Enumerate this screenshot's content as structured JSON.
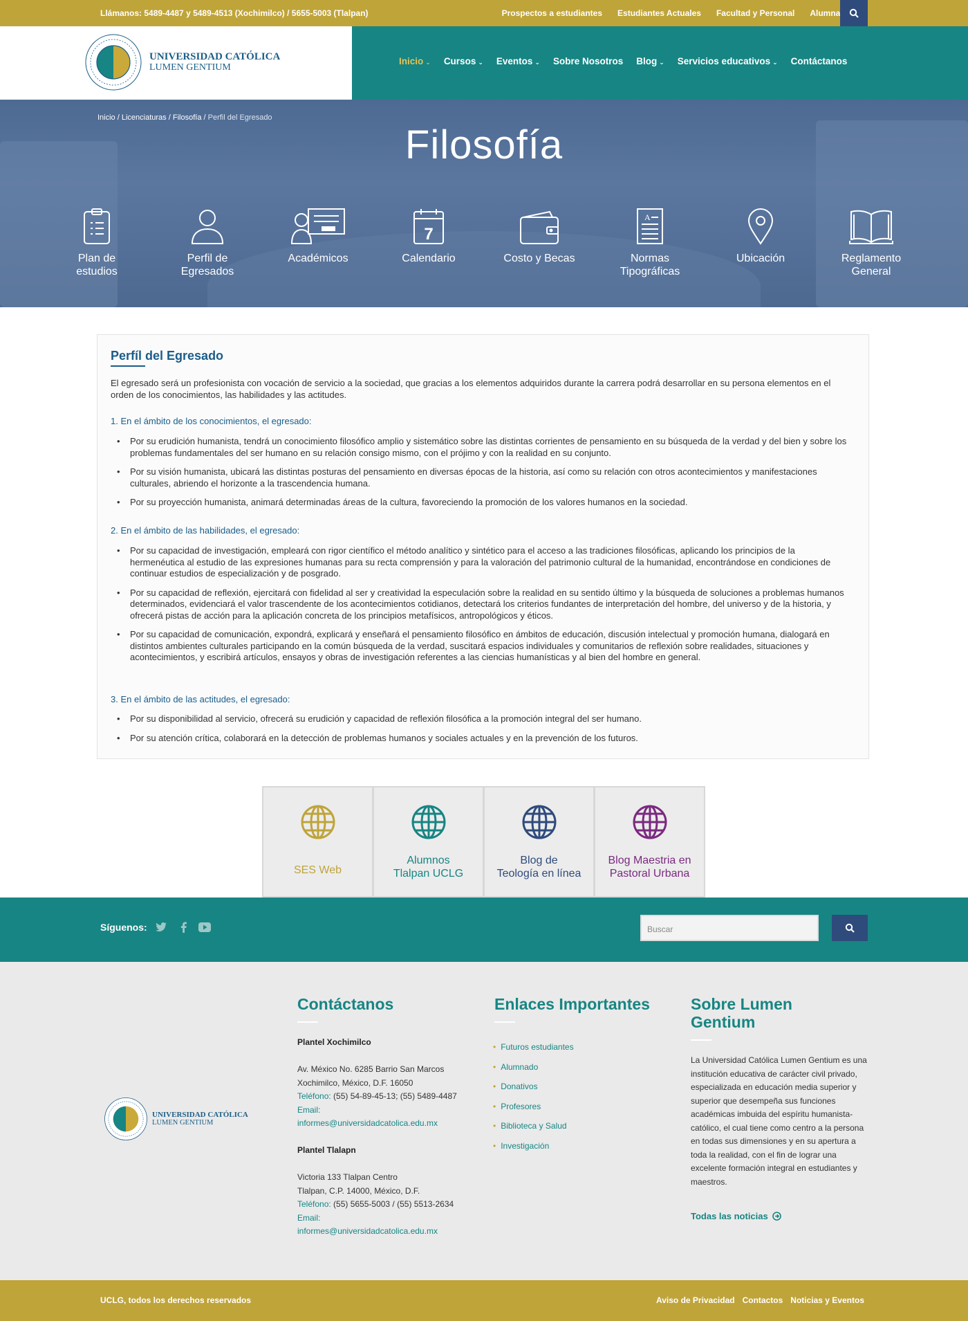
{
  "topbar": {
    "phone": "Llámanos: 5489-4487 y 5489-4513 (Xochimilco) / 5655-5003 (Tlalpan)",
    "links": [
      "Prospectos a estudiantes",
      "Estudiantes Actuales",
      "Facultad y Personal",
      "Alumnado"
    ],
    "search_icon": "search-icon"
  },
  "header": {
    "logo_line1": "UNIVERSIDAD CATÓLICA",
    "logo_line2": "LUMEN GENTIUM",
    "nav": [
      "Inicio",
      "Cursos",
      "Eventos",
      "Sobre Nosotros",
      "Blog",
      "Servicios educativos",
      "Contáctanos"
    ],
    "active_color": "#e3c45a"
  },
  "hero": {
    "breadcrumb": [
      "Inicio",
      "Licenciaturas",
      "Filosofía",
      "Perfil del Egresado"
    ],
    "title": "Filosofía",
    "items": [
      {
        "line1": "Plan de",
        "line2": "estudios",
        "icon": "clipboard-icon"
      },
      {
        "line1": "Perfil de",
        "line2": "Egresados",
        "icon": "user-icon"
      },
      {
        "line1": "Académicos",
        "line2": "",
        "icon": "teacher-board-icon"
      },
      {
        "line1": "Calendario",
        "line2": "",
        "icon": "calendar-icon"
      },
      {
        "line1": "Costo y Becas",
        "line2": "",
        "icon": "wallet-icon"
      },
      {
        "line1": "Normas",
        "line2": "Tipográficas",
        "icon": "document-icon"
      },
      {
        "line1": "Ubicación",
        "line2": "",
        "icon": "map-pin-icon"
      },
      {
        "line1": "Reglamento",
        "line2": "General",
        "icon": "book-icon"
      }
    ]
  },
  "content": {
    "title": "Perfíl del Egresado",
    "intro": "El egresado será un profesionista con vocación de servicio a la sociedad, que gracias a los elementos adquiridos durante la carrera podrá desarrollar en su persona elementos en el orden de los conocimientos, las habilidades y las actitudes.",
    "sections": [
      {
        "heading": "1. En el ámbito de los conocimientos, el egresado:",
        "items": [
          "Por su erudición humanista, tendrá un conocimiento filosófico amplio y sistemático sobre las distintas corrientes de pensamiento en su búsqueda de la verdad y del bien y sobre los problemas fundamentales del ser humano en su relación consigo mismo, con el prójimo y con la realidad en su conjunto.",
          "Por su visión humanista, ubicará las distintas posturas del pensamiento en diversas épocas de la historia, así como su relación con otros acontecimientos y manifestaciones culturales, abriendo el horizonte a la trascendencia humana.",
          "Por su proyección humanista, animará determinadas áreas de la cultura, favoreciendo la promoción de los valores humanos en la sociedad."
        ]
      },
      {
        "heading": "2. En el ámbito de las habilidades, el egresado:",
        "items": [
          "Por su capacidad de investigación, empleará con rigor científico el método analítico y sintético para el acceso a las tradiciones filosóficas, aplicando los principios de la hermenéutica al estudio de las expresiones humanas para su recta comprensión y para la valoración del patrimonio cultural de la humanidad, encontrándose en condiciones de continuar estudios de especialización y de posgrado.",
          "Por su capacidad de reflexión, ejercitará con fidelidad al ser y creatividad la especulación sobre la realidad en su sentido último y la búsqueda de soluciones a problemas humanos determinados, evidenciará el valor trascendente de los acontecimientos cotidianos, detectará los criterios fundantes de interpretación del hombre, del universo y de la historia, y ofrecerá pistas de acción para la aplicación concreta de los principios metafísicos, antropológicos y éticos.",
          "Por su capacidad de comunicación, expondrá, explicará y enseñará el pensamiento filosófico en ámbitos de educación, discusión intelectual y promoción humana, dialogará en distintos ambientes culturales participando en la común búsqueda de la verdad, suscitará espacios individuales y comunitarios de reflexión sobre realidades, situaciones y acontecimientos, y escribirá artículos, ensayos y obras de investigación referentes a las ciencias humanísticas y al bien del hombre en general."
        ]
      },
      {
        "heading": "3. En el ámbito de las actitudes, el egresado:",
        "items": [
          "Por su disponibilidad al servicio, ofrecerá su erudición y capacidad de reflexión filosófica a la promoción integral del ser humano.",
          "Por su atención crítica, colaborará en la detección de problemas humanos y sociales actuales y en la prevención de los futuros."
        ]
      }
    ]
  },
  "tiles": [
    {
      "line1": "SES Web",
      "line2": "",
      "color": "#bfa43a",
      "icon": "globe-icon"
    },
    {
      "line1": "Alumnos",
      "line2": "Tlalpan UCLG",
      "color": "#178583",
      "icon": "globe-icon"
    },
    {
      "line1": "Blog de",
      "line2": "Teología en línea",
      "color": "#2f4b7c",
      "icon": "globe-icon"
    },
    {
      "line1": "Blog Maestria en",
      "line2": "Pastoral Urbana",
      "color": "#7a2a7f",
      "icon": "globe-icon"
    }
  ],
  "social": {
    "label": "Síguenos:",
    "icons": [
      "twitter-icon",
      "facebook-icon",
      "youtube-icon"
    ],
    "search_placeholder": "Buscar"
  },
  "footer": {
    "contact": {
      "title": "Contáctanos",
      "campus1": {
        "name": "Plantel Xochimilco",
        "addr1": "Av. México No. 6285 Barrio San Marcos",
        "addr2": "Xochimilco, México, D.F. 16050",
        "phone_label": "Teléfono:",
        "phone": " (55) 54-89-45-13; (55) 5489-4487",
        "email_label": "Email:",
        "email": "informes@universidadcatolica.edu.mx"
      },
      "campus2": {
        "name": "Plantel Tlalapn",
        "addr1": "Victoria 133 Tlalpan Centro",
        "addr2": "Tlalpan, C.P. 14000, México, D.F.",
        "phone_label": "Teléfono:",
        "phone": " (55) 5655-5003 / (55) 5513-2634",
        "email_label": "Email:",
        "email": "informes@universidadcatolica.edu.mx"
      }
    },
    "links": {
      "title": "Enlaces Importantes",
      "items": [
        "Futuros estudiantes",
        "Alumnado",
        "Donativos",
        "Profesores",
        "Biblioteca y Salud",
        "Investigación"
      ]
    },
    "about": {
      "title_line1": "Sobre Lumen",
      "title_line2": "Gentium",
      "text": "La Universidad Católica Lumen Gentium es una institución educativa de carácter civil privado, especializada en educación media superior y superior que desempeña sus funciones académicas imbuida del espíritu humanista-católico, el cual tiene como centro a la persona en todas sus dimensiones y en su apertura a toda la realidad, con el fin de lograr una excelente formación integral en estudiantes y maestros.",
      "all_news": "Todas las noticias"
    }
  },
  "bottom": {
    "copyright": "UCLG, todos los derechos reservados",
    "links": [
      "Aviso de Privacidad",
      "Contactos",
      "Noticias y Eventos"
    ]
  }
}
